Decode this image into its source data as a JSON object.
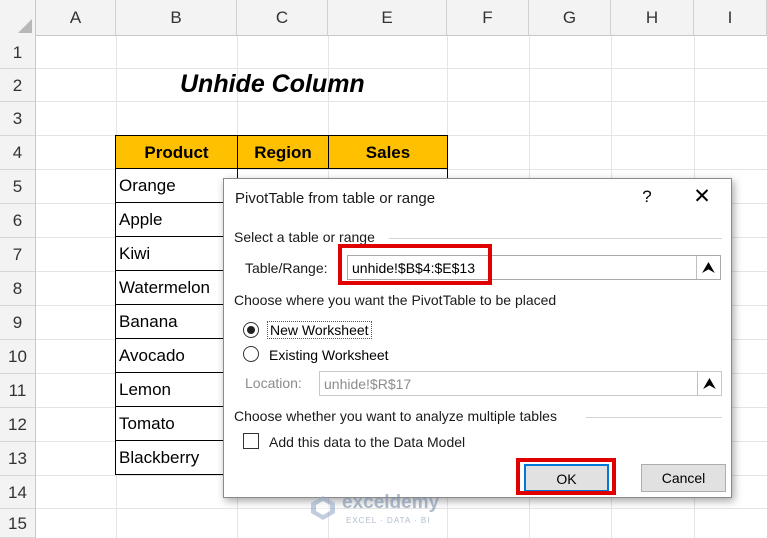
{
  "sheet": {
    "columns": [
      "A",
      "B",
      "C",
      "E",
      "F",
      "G",
      "H",
      "I"
    ],
    "rows": [
      "1",
      "2",
      "3",
      "4",
      "5",
      "6",
      "7",
      "8",
      "9",
      "10",
      "11",
      "12",
      "13",
      "14",
      "15"
    ],
    "title": "Unhide Column",
    "table": {
      "headers": [
        "Product",
        "Region",
        "Sales"
      ],
      "products": [
        "Orange",
        "Apple",
        "Kiwi",
        "Watermelon",
        "Banana",
        "Avocado",
        "Lemon",
        "Tomato",
        "Blackberry"
      ]
    }
  },
  "dialog": {
    "title": "PivotTable from table or range",
    "help_glyph": "?",
    "close_glyph": "✕",
    "select_section": "Select a table or range",
    "range_label": "Table/Range:",
    "range_value": "unhide!$B$4:$E$13",
    "range_button_icon": "collapse-range-icon",
    "placement_section": "Choose where you want the PivotTable to be placed",
    "new_worksheet": "New Worksheet",
    "existing_worksheet": "Existing Worksheet",
    "selected_option": "new_worksheet",
    "location_label": "Location:",
    "location_value": "unhide!$R$17",
    "multiple_section": "Choose whether you want to analyze multiple tables",
    "data_model_label": "Add this data to the Data Model",
    "data_model_checked": false,
    "ok_label": "OK",
    "cancel_label": "Cancel"
  },
  "watermark": {
    "name": "exceldemy",
    "tagline": "EXCEL · DATA · BI"
  },
  "colors": {
    "header_fill": "#ffc000",
    "highlight": "#e00000",
    "focus": "#0078d7"
  }
}
